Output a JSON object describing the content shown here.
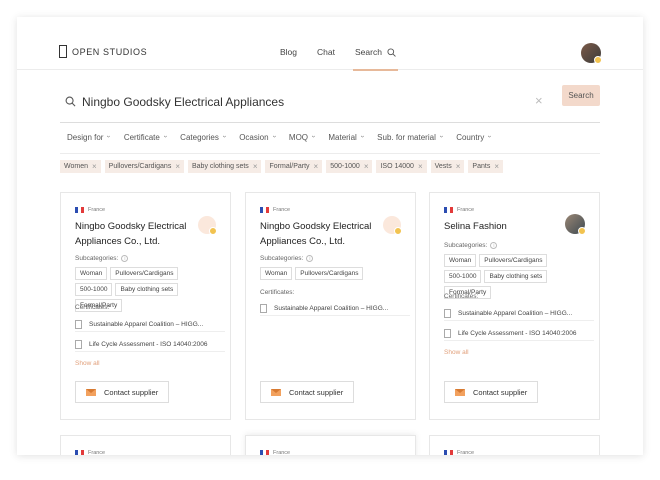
{
  "header": {
    "logo_text": "OPEN STUDIOS",
    "nav": [
      {
        "label": "Blog"
      },
      {
        "label": "Chat"
      },
      {
        "label": "Search"
      }
    ]
  },
  "search": {
    "value": "Ningbo Goodsky Electrical Appliances",
    "clear_icon": "×",
    "button_label": "Search"
  },
  "filters": [
    "Design for",
    "Certificate",
    "Categories",
    "Ocasion",
    "MOQ",
    "Material",
    "Sub. for material",
    "Country"
  ],
  "active_tags": [
    "Women",
    "Pullovers/Cardigans",
    "Baby clothing sets",
    "Formal/Party",
    "500-1000",
    "ISO 14000",
    "Vests",
    "Pants"
  ],
  "labels": {
    "subcategories": "Subcategories:",
    "certificates": "Certificates:",
    "show_all": "Show all",
    "contact": "Contact supplier",
    "country": "France"
  },
  "cards": [
    {
      "title": "Ningbo Goodsky Electrical Appliances Co., Ltd.",
      "subcategories": [
        "Woman",
        "Pullovers/Cardigans",
        "500-1000",
        "Baby clothing sets",
        "Formal/Party"
      ],
      "certificates": [
        "Sustainable Apparel Coalition – HIGG...",
        "Life Cycle Assessment - ISO 14040:2006"
      ]
    },
    {
      "title": "Ningbo Goodsky Electrical Appliances Co., Ltd.",
      "subcategories": [
        "Woman",
        "Pullovers/Cardigans"
      ],
      "certificates": [
        "Sustainable Apparel Coalition – HIGG..."
      ]
    },
    {
      "title": "Selina Fashion",
      "subcategories": [
        "Woman",
        "Pullovers/Cardigans",
        "500-1000",
        "Baby clothing sets",
        "Formal/Party"
      ],
      "certificates": [
        "Sustainable Apparel Coalition – HIGG...",
        "Life Cycle Assessment - ISO 14040:2006"
      ]
    }
  ],
  "colors": {
    "accent": "#e7b99a",
    "button_bg": "#f3d9cb",
    "tag_bg": "#f6ece6",
    "link": "#e1a07b"
  }
}
